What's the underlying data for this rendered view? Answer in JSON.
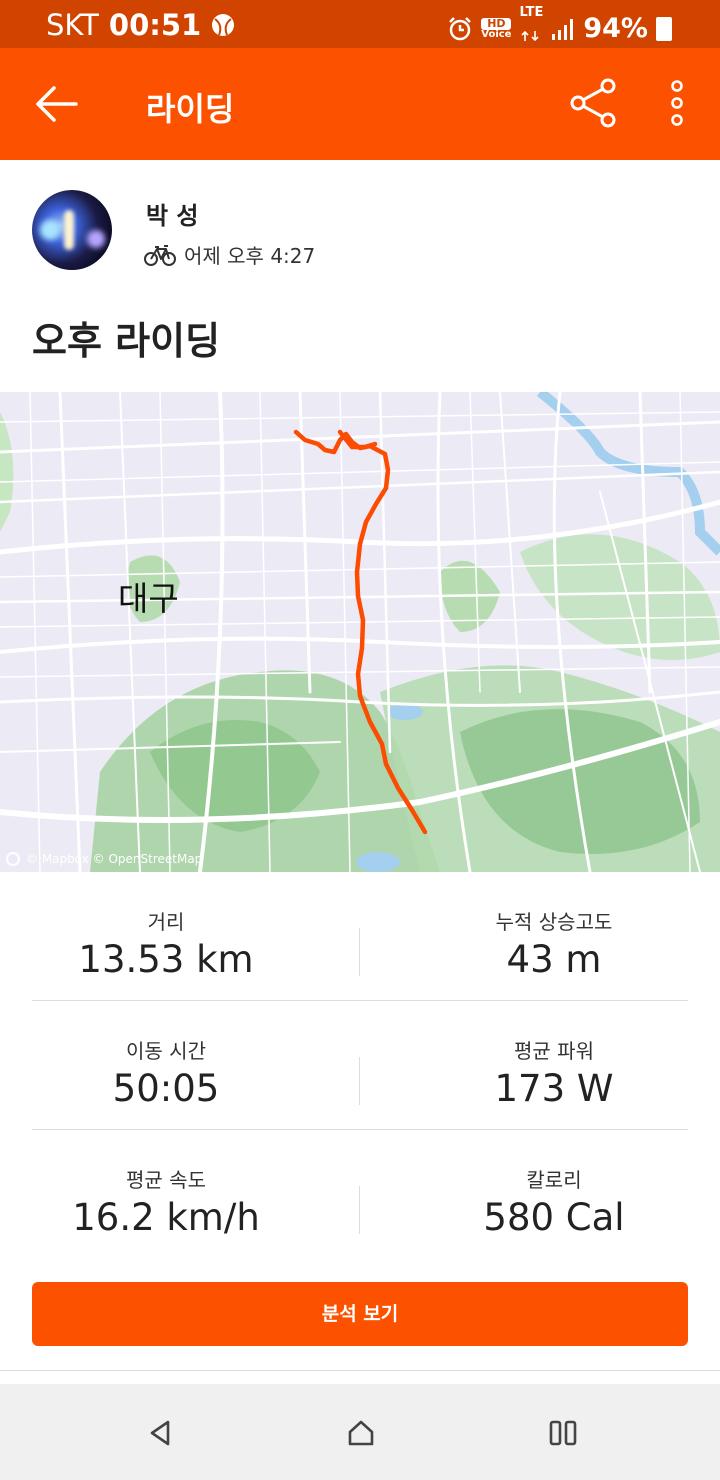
{
  "status_bar": {
    "carrier": "SKT",
    "time": "00:51",
    "hd_label": "HD",
    "voice_label": "Voice",
    "lte_label": "LTE",
    "battery": "94%"
  },
  "app_bar": {
    "title": "라이딩"
  },
  "athlete": {
    "name": "박 성",
    "date": "어제 오후 4:27"
  },
  "activity": {
    "title": "오후 라이딩"
  },
  "map": {
    "city_label": "대구",
    "attribution": "© Mapbox © OpenStreetMap",
    "route_color": "#fc4c02"
  },
  "stats": [
    {
      "left_label": "거리",
      "left_value": "13.53 km",
      "right_label": "누적 상승고도",
      "right_value": "43 m"
    },
    {
      "left_label": "이동 시간",
      "left_value": "50:05",
      "right_label": "평균 파워",
      "right_value": "173 W"
    },
    {
      "left_label": "평균 속도",
      "left_value": "16.2 km/h",
      "right_label": "칼로리",
      "right_value": "580 Cal"
    }
  ],
  "actions": {
    "analysis_button": "분석 보기"
  },
  "colors": {
    "brand": "#fc5200",
    "status_bar": "#d14400"
  }
}
